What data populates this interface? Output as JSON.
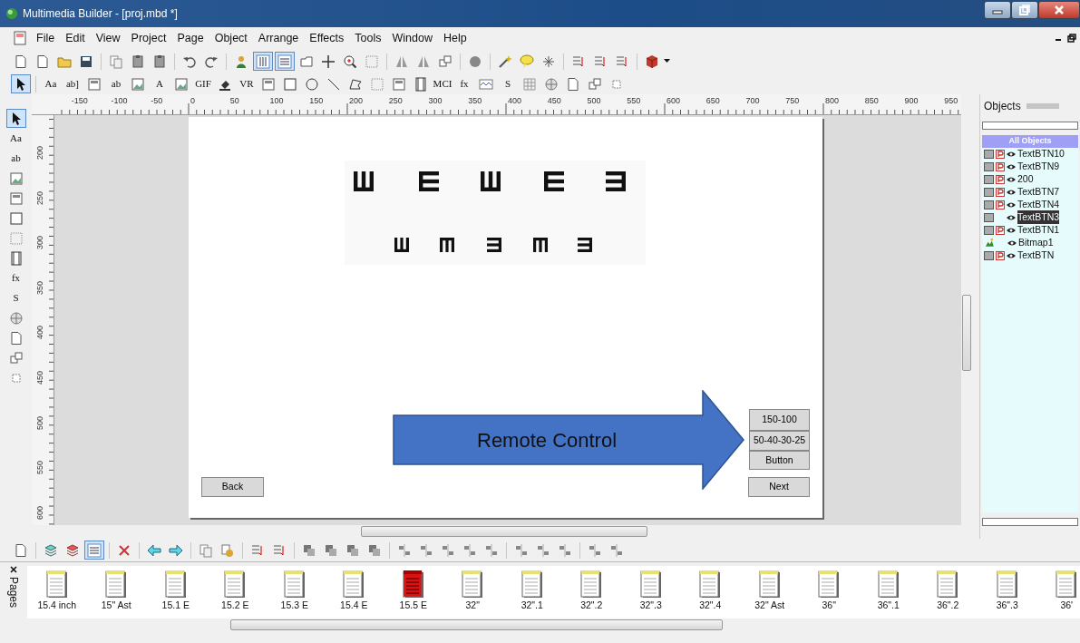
{
  "window": {
    "title": "Multimedia Builder - [proj.mbd *]"
  },
  "menu": [
    "File",
    "Edit",
    "View",
    "Project",
    "Page",
    "Object",
    "Arrange",
    "Effects",
    "Tools",
    "Window",
    "Help"
  ],
  "toolbars": {
    "standard": [
      {
        "selected": false
      },
      {
        "selected": false
      },
      {
        "selected": false
      },
      {
        "selected": false
      },
      {
        "selected": false
      },
      {
        "selected": false
      },
      {
        "selected": false
      },
      {
        "selected": false
      },
      {
        "selected": false
      },
      {
        "selected": false
      },
      {
        "selected": true
      },
      {
        "selected": true
      },
      {
        "selected": false
      },
      {
        "selected": false
      },
      {
        "selected": false
      },
      {
        "selected": false
      },
      {
        "selected": false
      },
      {
        "selected": false
      },
      {
        "selected": false
      },
      {
        "selected": false
      },
      {
        "selected": false
      },
      {
        "selected": false
      },
      {
        "selected": false
      },
      {
        "selected": false
      },
      {
        "selected": false
      },
      {
        "selected": false
      },
      {
        "selected": false
      }
    ],
    "objects": [
      {
        "selected": true
      },
      {
        "selected": false,
        "label": "Aa"
      },
      {
        "selected": false,
        "label": "ab]"
      },
      {
        "selected": false
      },
      {
        "selected": false,
        "label": "ab"
      },
      {
        "selected": false
      },
      {
        "selected": false,
        "label": "A"
      },
      {
        "selected": false
      },
      {
        "selected": false,
        "label": "GIF"
      },
      {
        "selected": false
      },
      {
        "selected": false,
        "label": "VR"
      },
      {
        "selected": false
      },
      {
        "selected": false
      },
      {
        "selected": false
      },
      {
        "selected": false
      },
      {
        "selected": false
      },
      {
        "selected": false
      },
      {
        "selected": false
      },
      {
        "selected": false
      },
      {
        "selected": false,
        "label": "MCI"
      },
      {
        "selected": false,
        "label": "fx"
      },
      {
        "selected": false
      },
      {
        "selected": false,
        "label": "S"
      },
      {
        "selected": false
      },
      {
        "selected": false
      },
      {
        "selected": false
      },
      {
        "selected": false
      },
      {
        "selected": false
      }
    ],
    "tools": [
      {
        "selected": true
      },
      {
        "selected": false,
        "label": "Aa"
      },
      {
        "selected": false,
        "label": "ab"
      },
      {
        "selected": false
      },
      {
        "selected": false
      },
      {
        "selected": false
      },
      {
        "selected": false
      },
      {
        "selected": false
      },
      {
        "selected": false,
        "label": "fx"
      },
      {
        "selected": false,
        "label": "S"
      },
      {
        "selected": false
      },
      {
        "selected": false
      },
      {
        "selected": false
      },
      {
        "selected": false
      }
    ],
    "pages": [
      {
        "selected": false
      },
      {
        "selected": false
      },
      {
        "selected": false
      },
      {
        "selected": true
      },
      {
        "selected": false
      },
      {
        "selected": false
      },
      {
        "selected": false
      },
      {
        "selected": false
      },
      {
        "selected": false
      },
      {
        "selected": false
      },
      {
        "selected": false
      },
      {
        "selected": false
      },
      {
        "selected": false
      },
      {
        "selected": false
      },
      {
        "selected": false
      },
      {
        "selected": false
      },
      {
        "selected": false
      },
      {
        "selected": false
      },
      {
        "selected": false
      },
      {
        "selected": false
      },
      {
        "selected": false
      },
      {
        "selected": false
      },
      {
        "selected": false
      },
      {
        "selected": false
      },
      {
        "selected": false
      }
    ]
  },
  "rulers": {
    "horizontal": [
      "-150",
      "-100",
      "-50",
      "0",
      "50",
      "100",
      "150",
      "200",
      "250",
      "300",
      "350",
      "400",
      "450",
      "500",
      "550",
      "600",
      "650",
      "700",
      "750",
      "800",
      "850",
      "900",
      "950"
    ],
    "vertical": [
      "200",
      "250",
      "300",
      "350",
      "400",
      "450",
      "500",
      "550",
      "600"
    ]
  },
  "canvas": {
    "buttons": [
      {
        "label": "150-100"
      },
      {
        "label": "50-40-30-25"
      },
      {
        "label": "Button"
      }
    ],
    "back": "Back",
    "next": "Next",
    "callout": "Remote Control"
  },
  "objects_panel": {
    "title": "Objects",
    "header": "All Objects",
    "items": [
      {
        "name": "TextBTN10",
        "kind": "button",
        "p": true,
        "selected": false
      },
      {
        "name": "TextBTN9",
        "kind": "button",
        "p": true,
        "selected": false
      },
      {
        "name": "200",
        "kind": "button",
        "p": true,
        "selected": false
      },
      {
        "name": "TextBTN7",
        "kind": "button",
        "p": true,
        "selected": false
      },
      {
        "name": "TextBTN4",
        "kind": "button",
        "p": true,
        "selected": false
      },
      {
        "name": "TextBTN3",
        "kind": "button",
        "p": false,
        "selected": true
      },
      {
        "name": "TextBTN1",
        "kind": "button",
        "p": true,
        "selected": false
      },
      {
        "name": "Bitmap1",
        "kind": "bitmap",
        "p": false,
        "selected": false
      },
      {
        "name": "TextBTN",
        "kind": "button",
        "p": true,
        "selected": false
      }
    ]
  },
  "pages_panel": {
    "title": "Pages",
    "pages": [
      {
        "label": "15.4 inch",
        "selected": false
      },
      {
        "label": "15\" Ast",
        "selected": false
      },
      {
        "label": "15.1 E",
        "selected": false
      },
      {
        "label": "15.2 E",
        "selected": false
      },
      {
        "label": "15.3 E",
        "selected": false
      },
      {
        "label": "15.4 E",
        "selected": false
      },
      {
        "label": "15.5 E",
        "selected": true
      },
      {
        "label": "32\"",
        "selected": false
      },
      {
        "label": "32\".1",
        "selected": false
      },
      {
        "label": "32\".2",
        "selected": false
      },
      {
        "label": "32\".3",
        "selected": false
      },
      {
        "label": "32\".4",
        "selected": false
      },
      {
        "label": "32\" Ast",
        "selected": false
      },
      {
        "label": "36\"",
        "selected": false
      },
      {
        "label": "36\".1",
        "selected": false
      },
      {
        "label": "36\".2",
        "selected": false
      },
      {
        "label": "36\".3",
        "selected": false
      },
      {
        "label": "36'",
        "selected": false
      }
    ]
  }
}
